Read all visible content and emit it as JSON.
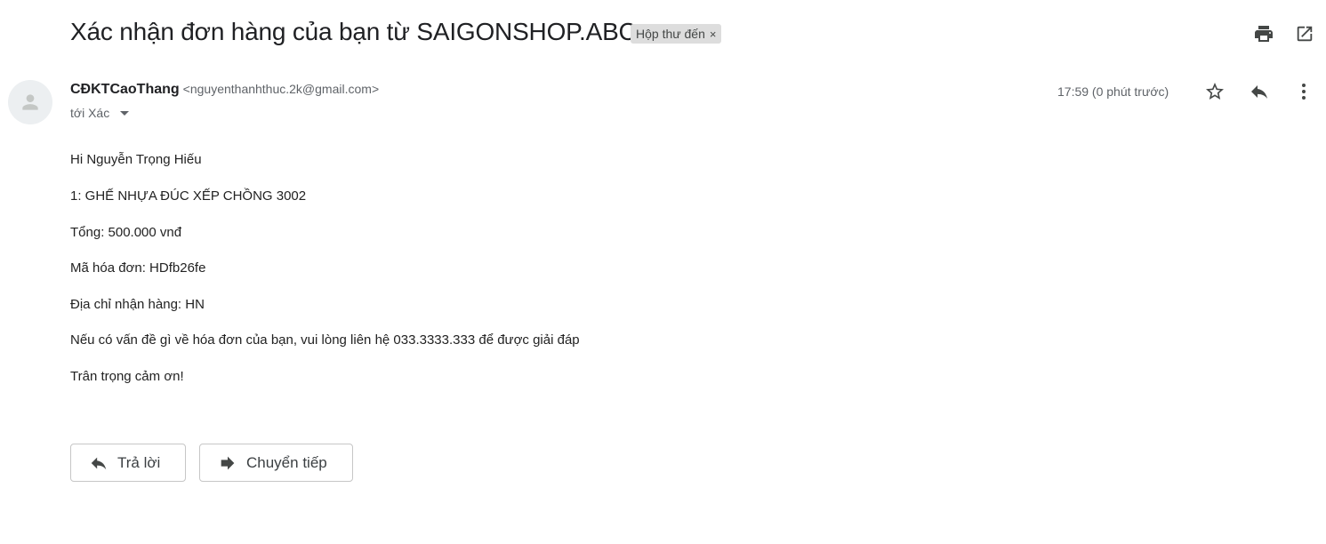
{
  "email": {
    "subject": "Xác nhận đơn hàng của bạn từ SAIGONSHOP.ABC",
    "label": "Hộp thư đến",
    "label_close": "×",
    "sender_name": "CĐKTCaoThang",
    "sender_email": "<nguyenthanhthuc.2k@gmail.com>",
    "to_text": "tới Xác",
    "timestamp": "17:59 (0 phút trước)",
    "body": [
      "Hi Nguyễn Trọng Hiếu",
      "1: GHẾ NHỰA ĐÚC XẾP CHỒNG 3002",
      "Tổng: 500.000 vnđ",
      "Mã hóa đơn: HDfb26fe",
      "Địa chỉ nhận hàng: HN",
      "Nếu có vấn đề gì về hóa đơn của bạn, vui lòng liên hệ 033.3333.333 để được giải đáp",
      "Trân trọng cảm ơn!"
    ]
  },
  "actions": {
    "reply_label": "Trả lời",
    "forward_label": "Chuyển tiếp"
  },
  "icons": {
    "print": "print-icon",
    "open_new_window": "open-in-new-window-icon",
    "star": "star-icon",
    "reply": "reply-icon",
    "more": "more-vert-icon",
    "forward": "forward-icon",
    "avatar": "person-icon"
  },
  "colors": {
    "text": "#222222",
    "muted": "#5f6368",
    "label_bg": "#dddddd",
    "icon": "#444746"
  }
}
